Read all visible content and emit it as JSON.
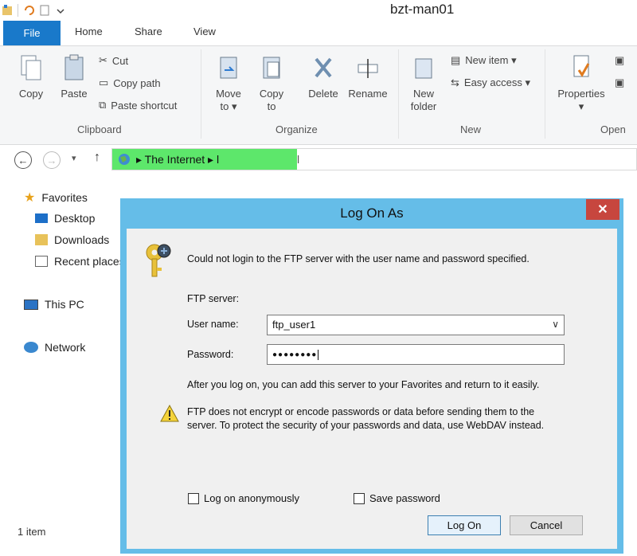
{
  "window": {
    "title": "bzt-man01"
  },
  "ribbon": {
    "tabs": {
      "file": "File",
      "home": "Home",
      "share": "Share",
      "view": "View"
    },
    "clipboard": {
      "copy": "Copy",
      "paste": "Paste",
      "cut": "Cut",
      "copy_path": "Copy path",
      "paste_shortcut": "Paste shortcut",
      "group": "Clipboard"
    },
    "organize": {
      "move_to_1": "Move",
      "move_to_2": "to ▾",
      "copy_to_1": "Copy",
      "copy_to_2": "to",
      "delete": "Delete",
      "rename": "Rename",
      "group": "Organize"
    },
    "new": {
      "new_folder_1": "New",
      "new_folder_2": "folder",
      "new_item": "New item ▾",
      "easy_access": "Easy access ▾",
      "group": "New"
    },
    "open": {
      "properties": "Properties",
      "group": "Open"
    }
  },
  "address": {
    "crumb": "▸  The Internet  ▸  l",
    "tail": "l"
  },
  "nav": {
    "favorites": "Favorites",
    "desktop": "Desktop",
    "downloads": "Downloads",
    "recent": "Recent places",
    "this_pc": "This PC",
    "network": "Network"
  },
  "status": {
    "items": "1 item"
  },
  "dialog": {
    "title": "Log On As",
    "close": "✕",
    "message": "Could not login to the FTP server with the user name and password specified.",
    "ftp_server_label": "FTP server:",
    "user_name_label": "User name:",
    "user_name_value": "ftp_user1",
    "password_label": "Password:",
    "password_value": "●●●●●●●●",
    "info": "After you log on, you can add this server to your Favorites and return to it easily.",
    "warning_1": "FTP does not encrypt or encode passwords or data before sending them to the",
    "warning_2": "server.  To protect the security of your passwords and data, use WebDAV instead.",
    "anonymous": "Log on anonymously",
    "save_password": "Save password",
    "log_on": "Log On",
    "cancel": "Cancel"
  },
  "colors": {
    "accent": "#1979ca",
    "dialog_frame": "#65bde8",
    "close_red": "#c7463e",
    "address_highlight": "#5de76b"
  }
}
